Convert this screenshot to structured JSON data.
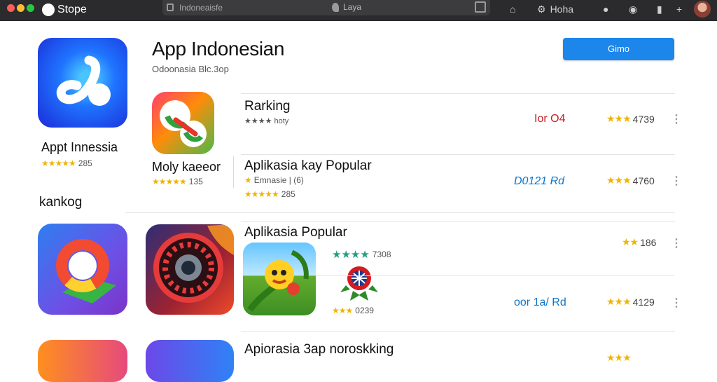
{
  "topbar": {
    "brand": "Stope",
    "search_query": "Indoneaisfe",
    "location": "Laya",
    "profile_text": "Hoha"
  },
  "hero": {
    "title": "App Indonesian",
    "subtitle": "Odoonasia Blc.3op",
    "cta": "Gimo",
    "app_name": "Appt Innessia",
    "stars": "★★★★★",
    "rating": "285"
  },
  "sidebar": {
    "section": "kankog"
  },
  "rows": [
    {
      "title": "Rarking",
      "meta": "★★★★ hoty",
      "price": "Ior O4",
      "stars": "★★★",
      "rating": "4739"
    },
    {
      "title": "Aplikasia kay Popular",
      "sub": "Emnasie | (6)",
      "stars_inline": "★★★★★",
      "rating_inline": "285",
      "price": "D0121 Rd",
      "stars": "★★★",
      "rating": "4760"
    },
    {
      "title": "Aplikasia Popular",
      "game_stars": "★★★★",
      "game_rating": "7308",
      "price": "oor 1a/ Rd",
      "stars": "★★",
      "rating": "186",
      "sub_stars": "★★★",
      "sub_rating": "0239",
      "rating2": "4129",
      "stars2": "★★★"
    },
    {
      "title": "Apiorasia 3ap noroskking"
    }
  ],
  "left_apps": [
    {
      "name": "Moly kaeeor",
      "stars": "★★★★★",
      "rating": "135"
    }
  ]
}
